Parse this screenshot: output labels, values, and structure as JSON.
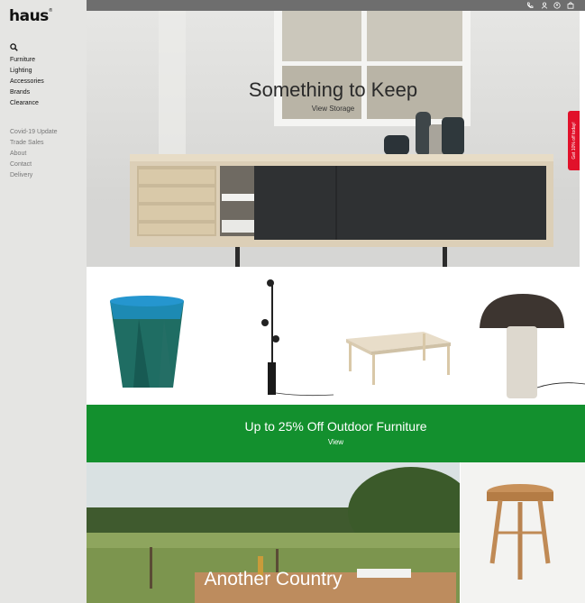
{
  "brand": {
    "logo": "haus",
    "trademark": "®"
  },
  "sidebar": {
    "search_icon": "search-icon",
    "main_nav": [
      "Furniture",
      "Lighting",
      "Accessories",
      "Brands",
      "Clearance"
    ],
    "secondary_nav": [
      "Covid-19 Update",
      "Trade Sales",
      "About",
      "Contact",
      "Delivery"
    ]
  },
  "topbar": {
    "icons": [
      "phone-icon",
      "account-icon",
      "location-icon",
      "bag-icon"
    ]
  },
  "hero": {
    "title": "Something to Keep",
    "link": "View Storage"
  },
  "side_tab": {
    "label": "Get 10% off today!"
  },
  "products": [
    {
      "icon": "bin-image"
    },
    {
      "icon": "floor-lamp-image"
    },
    {
      "icon": "table-image"
    },
    {
      "icon": "table-lamp-image"
    }
  ],
  "promo": {
    "title": "Up to 25% Off Outdoor Furniture",
    "link": "View",
    "color": "#13902e"
  },
  "feature": {
    "title": "Another Country"
  },
  "colors": {
    "sidebar": "#e5e5e3",
    "topbar": "#6e6e6e",
    "side_tab": "#e1112a"
  }
}
